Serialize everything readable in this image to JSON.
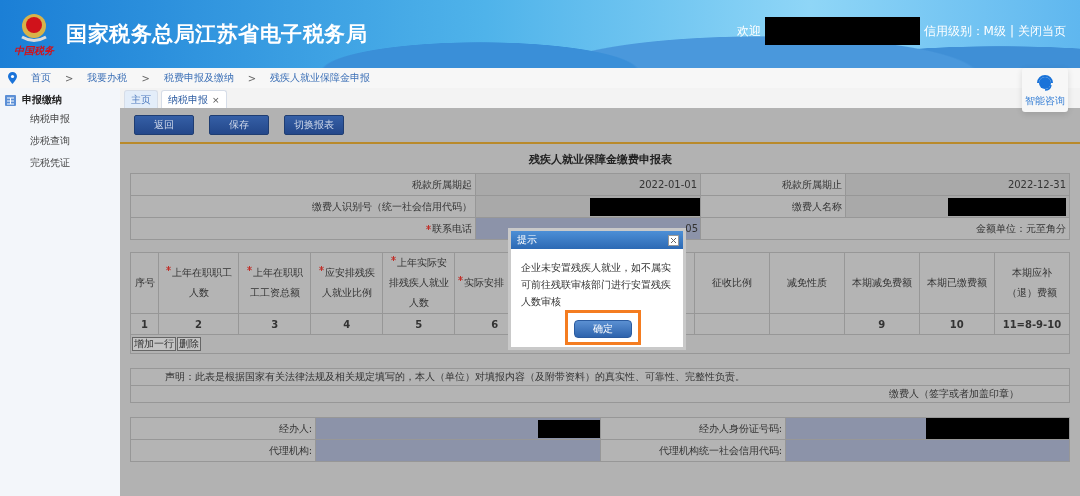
{
  "header": {
    "title": "国家税务总局江苏省电子税务局",
    "logo_caption": "中国税务",
    "welcome": "欢迎",
    "credit": "信用级别：M级",
    "divider": "|",
    "close": "关闭当页"
  },
  "breadcrumb": {
    "separator": ">",
    "items": [
      "首页",
      "我要办税",
      "税费申报及缴纳",
      "残疾人就业保障金申报"
    ]
  },
  "assistant": {
    "label": "智能咨询"
  },
  "sidebar": {
    "section": "申报缴纳",
    "items": [
      {
        "label": "纳税申报",
        "selected": false
      },
      {
        "label": "涉税查询",
        "selected": false
      },
      {
        "label": "完税凭证",
        "selected": false
      }
    ]
  },
  "tabs": [
    {
      "label": "主页",
      "selected": false,
      "closable": false
    },
    {
      "label": "纳税申报",
      "selected": true,
      "closable": true,
      "close": "×"
    }
  ],
  "toolbar": [
    "返回",
    "保存",
    "切换报表"
  ],
  "form_title": "残疾人就业保障金缴费申报表",
  "info": {
    "period_start_label": "税款所属期起",
    "period_start": "2022-01-01",
    "period_end_label": "税款所属期止",
    "period_end": "2022-12-31",
    "id_label": "缴费人识别号（统一社会信用代码）",
    "name_label": "缴费人名称",
    "phone_label": "联系电话",
    "phone_required": true,
    "phone_value": "05",
    "unit": "金额单位：元至角分"
  },
  "table": {
    "columns": [
      {
        "header": "序号",
        "number": "1",
        "required": false
      },
      {
        "header": "上年在职职工人数",
        "number": "2",
        "required": true
      },
      {
        "header": "上年在职职工工资总额",
        "number": "3",
        "required": true
      },
      {
        "header": "应安排残疾人就业比例",
        "number": "4",
        "required": true
      },
      {
        "header": "上年实际安排残疾人就业人数",
        "number": "5",
        "required": true
      },
      {
        "header": "实际安排",
        "number": "6",
        "required": true
      },
      {
        "header": "征收比例",
        "required": false
      },
      {
        "header": "减免性质",
        "required": false
      },
      {
        "header": "本期减免费额",
        "number": "9",
        "required": false
      },
      {
        "header": "本期已缴费额",
        "number": "10",
        "required": false
      },
      {
        "header": "本期应补（退）费额",
        "number": "11=8-9-10",
        "required": false
      }
    ],
    "row_buttons": [
      "增加一行",
      "删除"
    ]
  },
  "declaration": {
    "text": "声明：此表是根据国家有关法律法规及相关规定填写的，本人（单位）对填报内容（及附带资料）的真实性、可靠性、完整性负责。",
    "signature": "缴费人（签字或者加盖印章）"
  },
  "agent": {
    "handler_label": "经办人:",
    "handler_id_label": "经办人身份证号码:",
    "agency_label": "代理机构:",
    "agency_code_label": "代理机构统一社会信用代码:"
  },
  "dialog": {
    "title": "提示",
    "message": "企业未安置残疾人就业，如不属实可前往残联审核部门进行安置残疾人数审核",
    "ok": "确定",
    "ok_highlighted": true
  }
}
